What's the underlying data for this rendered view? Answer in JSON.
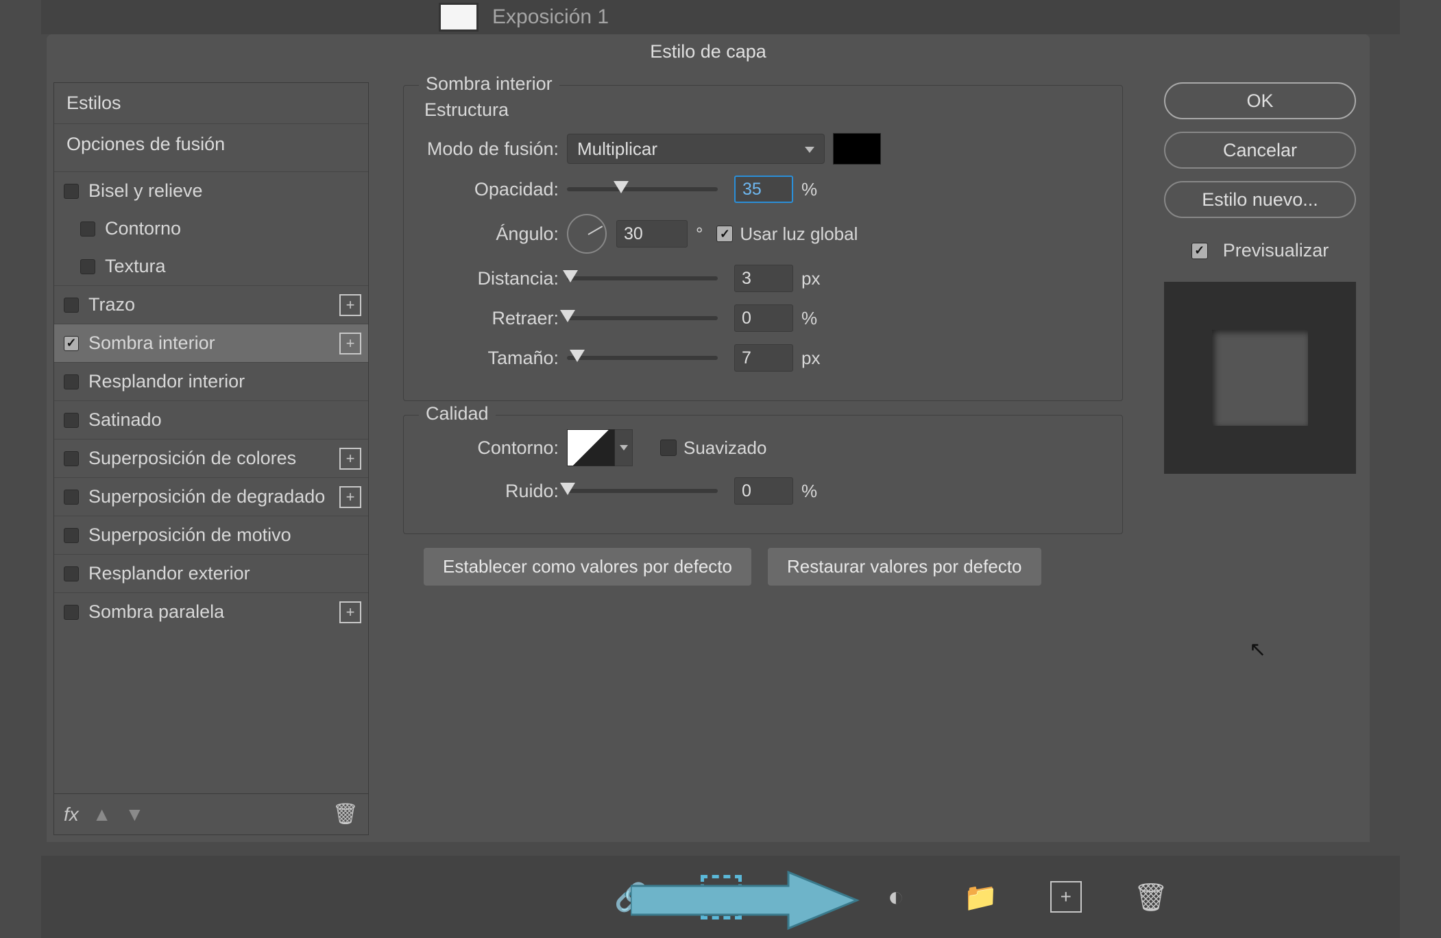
{
  "bg": {
    "layer_name": "Exposición 1"
  },
  "dialog": {
    "title": "Estilo de capa",
    "styles_header": "Estilos",
    "blend_options": "Opciones de fusión",
    "items": {
      "bevel": "Bisel y relieve",
      "contour": "Contorno",
      "texture": "Textura",
      "stroke": "Trazo",
      "inner_shadow": "Sombra interior",
      "inner_glow": "Resplandor interior",
      "satin": "Satinado",
      "color_overlay": "Superposición de colores",
      "gradient_overlay": "Superposición de degradado",
      "pattern_overlay": "Superposición de motivo",
      "outer_glow": "Resplandor exterior",
      "drop_shadow": "Sombra paralela"
    }
  },
  "center": {
    "section_title": "Sombra interior",
    "structure_title": "Estructura",
    "blend_mode_label": "Modo de fusión:",
    "blend_mode_value": "Multiplicar",
    "opacity_label": "Opacidad:",
    "opacity_value": "35",
    "opacity_unit": "%",
    "angle_label": "Ángulo:",
    "angle_value": "30",
    "angle_unit": "°",
    "global_light": "Usar luz global",
    "distance_label": "Distancia:",
    "distance_value": "3",
    "distance_unit": "px",
    "choke_label": "Retraer:",
    "choke_value": "0",
    "choke_unit": "%",
    "size_label": "Tamaño:",
    "size_value": "7",
    "size_unit": "px",
    "quality_title": "Calidad",
    "contour_label": "Contorno:",
    "antialiased": "Suavizado",
    "noise_label": "Ruido:",
    "noise_value": "0",
    "noise_unit": "%",
    "make_default": "Establecer como valores por defecto",
    "reset_default": "Restaurar valores por defecto"
  },
  "right": {
    "ok": "OK",
    "cancel": "Cancelar",
    "new_style": "Estilo nuevo...",
    "preview": "Previsualizar"
  },
  "footer": {
    "fx": "fx"
  }
}
